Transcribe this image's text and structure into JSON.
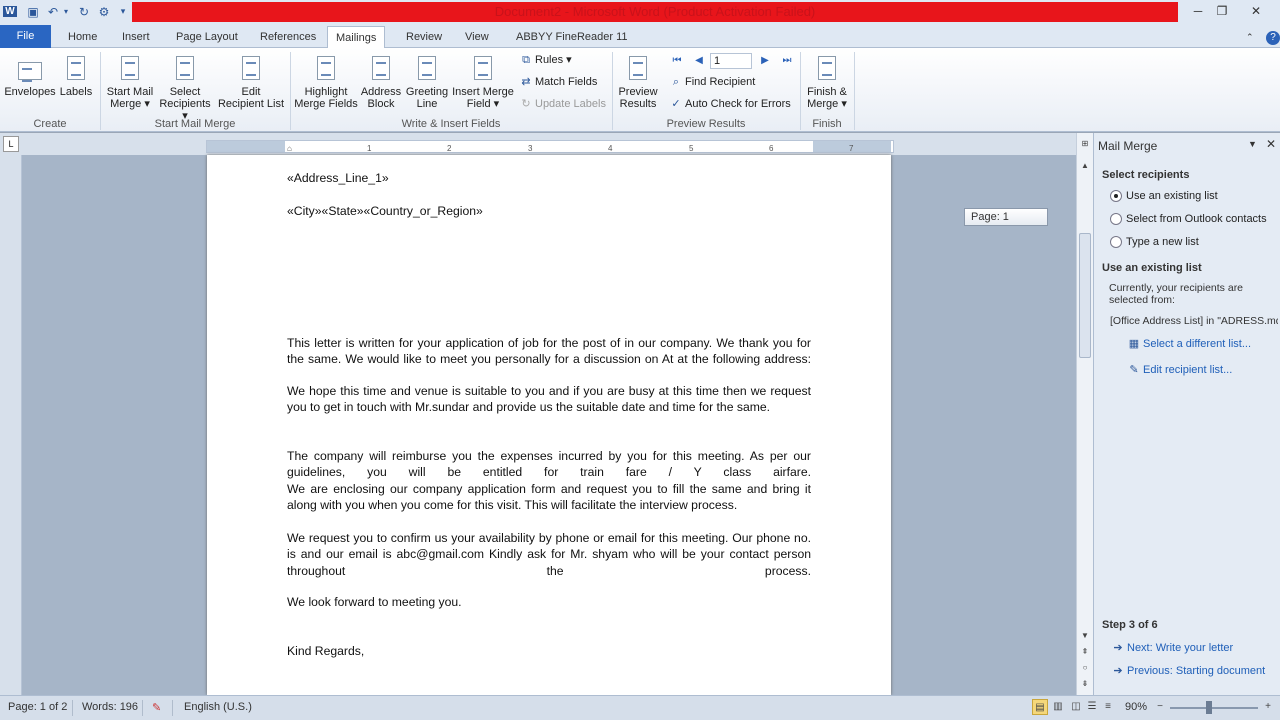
{
  "window": {
    "title": "Document2 - Microsoft Word (Product Activation Failed)",
    "accent": "#e8151b"
  },
  "tabs": [
    "File",
    "Home",
    "Insert",
    "Page Layout",
    "References",
    "Mailings",
    "Review",
    "View",
    "ABBYY FineReader 11"
  ],
  "active_tab": "Mailings",
  "ribbon": {
    "create": {
      "label": "Create",
      "envelopes": "Envelopes",
      "labels": "Labels"
    },
    "start": {
      "label": "Start Mail Merge",
      "start_l1": "Start Mail",
      "start_l2": "Merge ▾",
      "select_l1": "Select",
      "select_l2": "Recipients ▾",
      "edit_l1": "Edit",
      "edit_l2": "Recipient List"
    },
    "write": {
      "label": "Write & Insert Fields",
      "highlight_l1": "Highlight",
      "highlight_l2": "Merge Fields",
      "address_l1": "Address",
      "address_l2": "Block",
      "greeting_l1": "Greeting",
      "greeting_l2": "Line",
      "insert_l1": "Insert Merge",
      "insert_l2": "Field ▾",
      "rules": "Rules ▾",
      "match": "Match Fields",
      "update": "Update Labels"
    },
    "preview": {
      "label": "Preview Results",
      "preview_l1": "Preview",
      "preview_l2": "Results",
      "record": "1",
      "find": "Find Recipient",
      "auto": "Auto Check for Errors"
    },
    "finish": {
      "label": "Finish",
      "finish_l1": "Finish &",
      "finish_l2": "Merge ▾"
    }
  },
  "document": {
    "address_line": "«Address_Line_1»",
    "city_line": "«City»«State»«Country_or_Region»",
    "para1": "This letter is written for your application of job for the post of in our company. We thank you for the same. We would like to meet you personally for a discussion on At at the following address:",
    "para2": "We hope this time and venue is suitable to you and if you are busy at this time then we request you to get in touch with Mr.sundar and provide us the suitable date and time for the same.",
    "para3": "The company will reimburse you the expenses incurred by you for this meeting. As per our guidelines, you will be entitled for train fare / Y class airfare.",
    "para4": " We are enclosing our company application form and request you to fill the same and bring it along with you when you come for this visit. This will facilitate the interview process.",
    "para5": " We request you to confirm us your availability by phone or email for this meeting. Our phone no. is and our email is abc@gmail.com Kindly ask for Mr. shyam who will be your contact person throughout the process.",
    "para6": "We look forward to meeting you.",
    "closing": "Kind Regards,",
    "page_tooltip": "Page: 1",
    "ruler_ticks": [
      "1",
      "1",
      "2",
      "3",
      "4",
      "5",
      "6",
      "7"
    ]
  },
  "taskpane": {
    "title": "Mail Merge",
    "select_heading": "Select recipients",
    "options": [
      "Use an existing list",
      "Select from Outlook contacts",
      "Type a new list"
    ],
    "selected_option": 0,
    "use_heading": "Use an existing list",
    "currently": "Currently, your recipients are selected from:",
    "source": "[Office Address List] in \"ADRESS.mdb",
    "link_select": "Select a different list...",
    "link_edit": "Edit recipient list...",
    "step": "Step 3 of 6",
    "next": "Next: Write your letter",
    "previous": "Previous: Starting document"
  },
  "status": {
    "page": "Page: 1 of 2",
    "words": "Words: 196",
    "language": "English (U.S.)",
    "zoom": "90%"
  }
}
